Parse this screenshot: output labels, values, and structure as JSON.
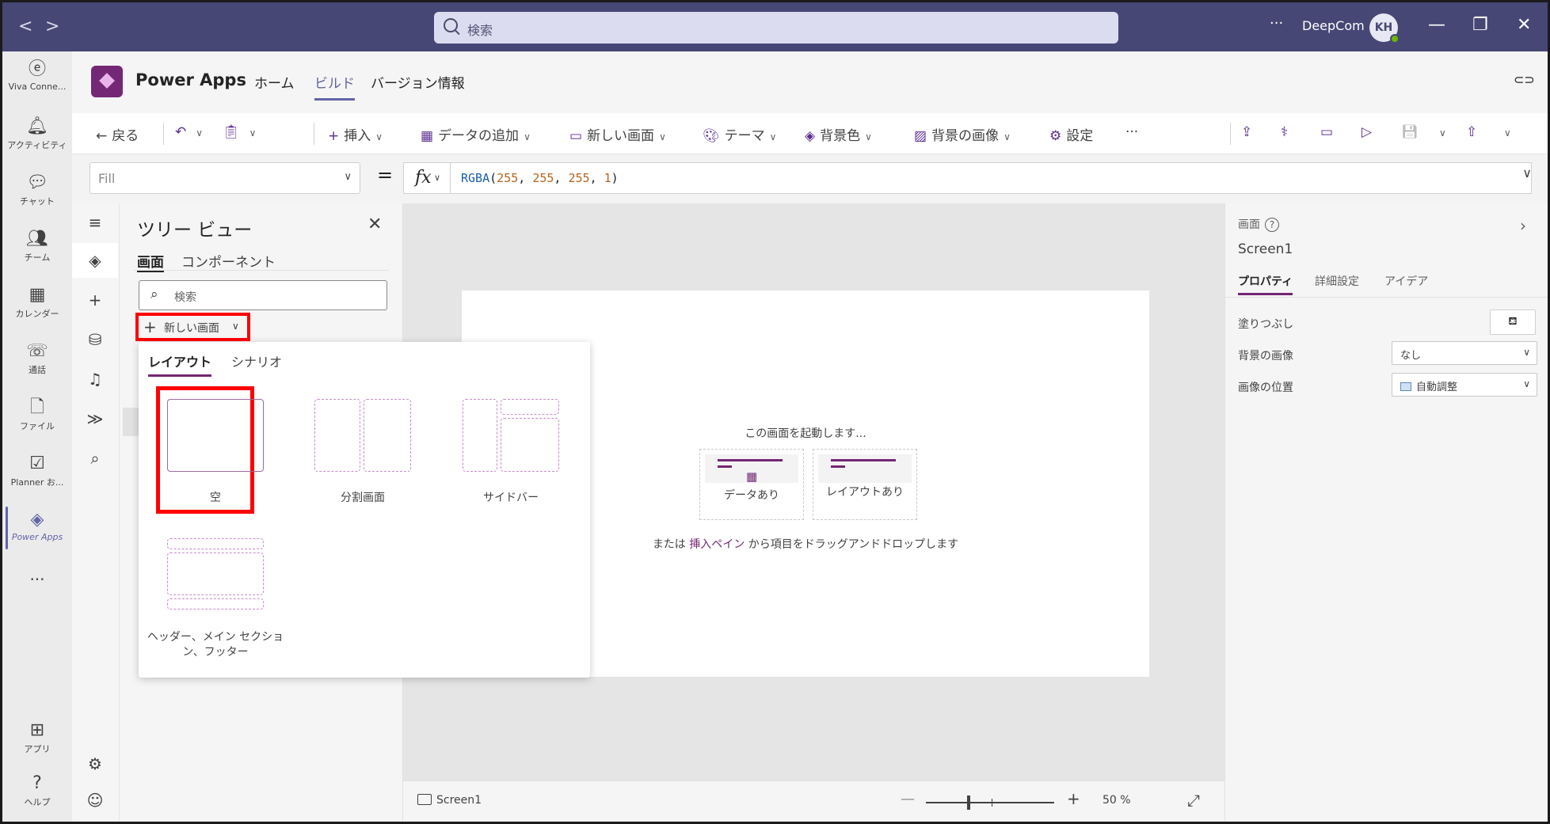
{
  "titlebar": {
    "back": "<",
    "forward": ">",
    "search_placeholder": "検索",
    "more": "···",
    "org": "DeepCom",
    "avatar": "KH",
    "minimize": "—",
    "restore": "❐",
    "close": "✕"
  },
  "rail": [
    {
      "label": "Viva Conne...",
      "icon": "viva-icon",
      "glyph": "ⓔ"
    },
    {
      "label": "アクティビティ",
      "icon": "bell-icon",
      "glyph": "🔔︎"
    },
    {
      "label": "チャット",
      "icon": "chat-icon",
      "glyph": "💬︎"
    },
    {
      "label": "チーム",
      "icon": "teams-icon",
      "glyph": "👥︎"
    },
    {
      "label": "カレンダー",
      "icon": "calendar-icon",
      "glyph": "▦"
    },
    {
      "label": "通話",
      "icon": "phone-icon",
      "glyph": "☏"
    },
    {
      "label": "ファイル",
      "icon": "file-icon",
      "glyph": "🗋"
    },
    {
      "label": "Planner お...",
      "icon": "planner-icon",
      "glyph": "☑"
    },
    {
      "label": "Power Apps",
      "icon": "powerapps-icon",
      "glyph": "◈"
    }
  ],
  "rail_more": "···",
  "rail_bottom": [
    {
      "label": "アプリ",
      "icon": "apps-icon",
      "glyph": "⊞"
    },
    {
      "label": "ヘルプ",
      "icon": "help-icon",
      "glyph": "?"
    }
  ],
  "app": {
    "title": "Power Apps",
    "tabs": [
      "ホーム",
      "ビルド",
      "バージョン情報"
    ],
    "active_tab": "ビルド"
  },
  "cmdbar": {
    "back": "戻る",
    "insert": "挿入",
    "add_data": "データの追加",
    "new_screen": "新しい画面",
    "theme": "テーマ",
    "bg_color": "背景色",
    "bg_image": "背景の画像",
    "settings": "設定",
    "more": "···"
  },
  "formula": {
    "property": "Fill",
    "equals": "=",
    "fx": "fx",
    "fn": "RGBA",
    "open": "(",
    "a": "255",
    "b": "255",
    "c": "255",
    "d": "1",
    "close": ")",
    "comma": ", "
  },
  "tree": {
    "title": "ツリー ビュー",
    "close": "✕",
    "tabs": [
      "画面",
      "コンポーネント"
    ],
    "search_placeholder": "検索",
    "new_screen": "新しい画面"
  },
  "dropdown": {
    "tabs": [
      "レイアウト",
      "シナリオ"
    ],
    "layouts": [
      "空",
      "分割画面",
      "サイドバー",
      "ヘッダー、メイン セクション、フッター"
    ]
  },
  "canvas": {
    "start": "この画面を起動します...",
    "card_data": "データあり",
    "card_layout": "レイアウトあり",
    "drag_prefix": "または",
    "drag_link": "挿入ペイン",
    "drag_suffix": "から項目をドラッグアンドドロップします"
  },
  "status": {
    "screen": "Screen1",
    "zoom_minus": "—",
    "zoom_plus": "+",
    "zoom": "50",
    "zoom_unit": "%",
    "zoom_level_percent": 50
  },
  "props": {
    "section": "画面",
    "help": "?",
    "screen_name": "Screen1",
    "tabs": [
      "プロパティ",
      "詳細設定",
      "アイデア"
    ],
    "fill_label": "塗りつぶし",
    "bg_image_label": "背景の画像",
    "bg_image_value": "なし",
    "image_pos_label": "画像の位置",
    "image_pos_value": "自動調整"
  },
  "colors": {
    "titlebar": "#464775",
    "accent": "#742774",
    "highlight": "#ff0000"
  }
}
